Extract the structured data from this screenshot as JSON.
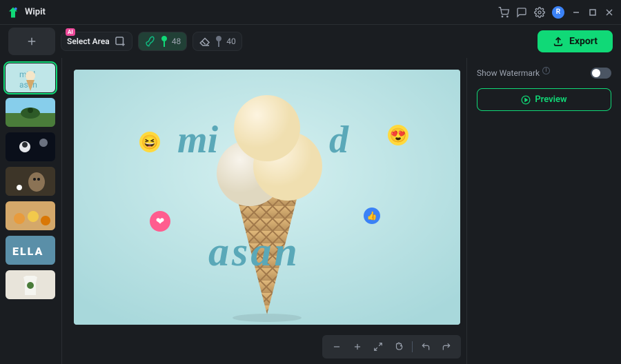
{
  "colors": {
    "accent": "#10d977",
    "bg": "#1a1d21",
    "panel": "#2a2e33"
  },
  "titlebar": {
    "app_name": "Wipit",
    "avatar_initial": "R"
  },
  "toolbar": {
    "ai_badge": "AI",
    "select_area_label": "Select Area",
    "brush_value": "48",
    "eraser_value": "40",
    "export_label": "Export"
  },
  "sidebar": {
    "items": [
      {
        "id": "icecream",
        "active": true
      },
      {
        "id": "landscape"
      },
      {
        "id": "astronaut"
      },
      {
        "id": "owl"
      },
      {
        "id": "pastries"
      },
      {
        "id": "ella"
      },
      {
        "id": "tshirt"
      }
    ]
  },
  "canvas": {
    "text_top_left_partial": "mi",
    "text_top_right_partial": "d",
    "text_bottom": "asan",
    "emojis": {
      "xd": "😆",
      "heart_eyes": "😍",
      "heart": "❤",
      "like": "👍"
    }
  },
  "rightpanel": {
    "watermark_label": "Show Watermark",
    "watermark_on": false,
    "preview_label": "Preview"
  }
}
